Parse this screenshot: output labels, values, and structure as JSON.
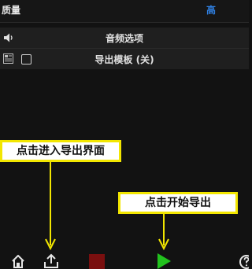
{
  "quality": {
    "label": "质量",
    "value": "高"
  },
  "audio_section": {
    "title": "音频选项"
  },
  "export_section": {
    "title": "导出模板 (关)",
    "checked": false
  },
  "callouts": {
    "export_hint": "点击进入导出界面",
    "start_hint": "点击开始导出"
  },
  "colors": {
    "accent": "#2f7fe0",
    "callout_border": "#f2e600",
    "play_green": "#22c21e",
    "stop_red": "#7a0f0f"
  },
  "toolbar": {
    "icons": [
      "home-icon",
      "export-icon",
      "stop-icon",
      "play-icon",
      "help-icon"
    ]
  }
}
